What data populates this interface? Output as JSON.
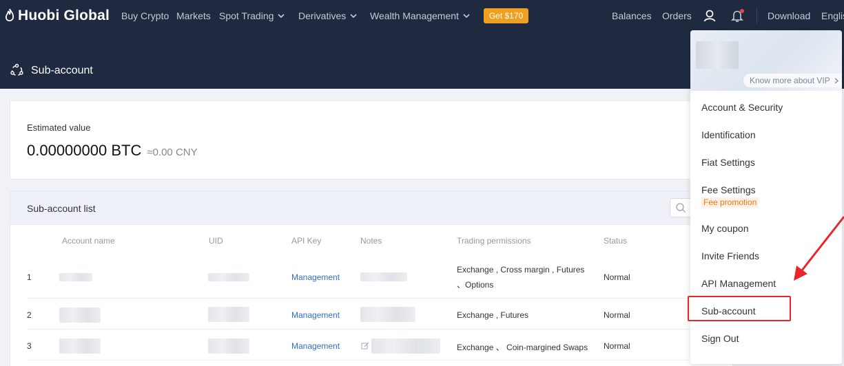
{
  "nav": {
    "logo": "Huobi Global",
    "items": [
      "Buy Crypto",
      "Markets",
      "Spot Trading",
      "Derivatives",
      "Wealth Management"
    ],
    "promo_button": "Get $170",
    "right_items": [
      "Balances",
      "Orders"
    ],
    "download": "Download",
    "language": "Englis"
  },
  "page": {
    "title": "Sub-account"
  },
  "estimated": {
    "label": "Estimated value",
    "value": "0.00000000 BTC",
    "cny": "≈0.00 CNY"
  },
  "list": {
    "title": "Sub-account list",
    "columns": [
      "Account name",
      "UID",
      "API Key",
      "Notes",
      "Trading permissions",
      "Status"
    ],
    "rows": [
      {
        "index": "1",
        "api_key": "Management",
        "permissions_line1": "Exchange , Cross margin , Futures",
        "permissions_line2": "、Options",
        "status": "Normal"
      },
      {
        "index": "2",
        "api_key": "Management",
        "permissions_line1": "Exchange , Futures",
        "permissions_line2": "",
        "status": "Normal"
      },
      {
        "index": "3",
        "api_key": "Management",
        "permissions_line1": "Exchange 、 Coin-margined Swaps",
        "permissions_line2": "",
        "status": "Normal"
      }
    ]
  },
  "dropdown": {
    "vip_link": "Know more about VIP",
    "items": [
      "Account & Security",
      "Identification",
      "Fiat Settings",
      "Fee Settings",
      "My coupon",
      "Invite Friends",
      "API Management",
      "Sub-account",
      "Sign Out"
    ],
    "fee_badge": "Fee promotion"
  },
  "colors": {
    "nav_bg": "#1f2a40",
    "promo": "#f0a020",
    "link": "#2f6ec7",
    "highlight": "#e8252b"
  }
}
